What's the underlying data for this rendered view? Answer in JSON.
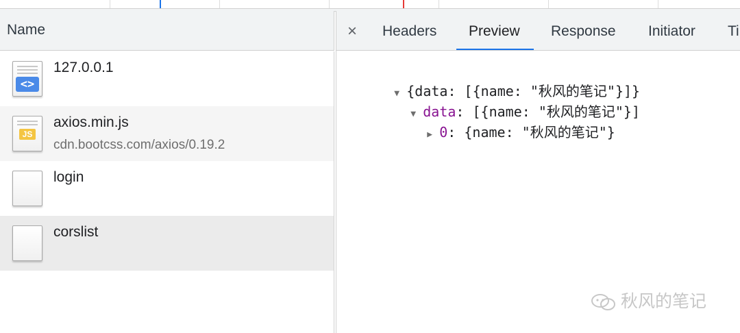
{
  "columns": {
    "name_header": "Name"
  },
  "requests": [
    {
      "name": "127.0.0.1",
      "subtitle": "",
      "icon": "html-document-icon"
    },
    {
      "name": "axios.min.js",
      "subtitle": "cdn.bootcss.com/axios/0.19.2",
      "icon": "javascript-file-icon"
    },
    {
      "name": "login",
      "subtitle": "",
      "icon": "generic-file-icon"
    },
    {
      "name": "corslist",
      "subtitle": "",
      "icon": "generic-file-icon"
    }
  ],
  "detail_tabs": {
    "close": "×",
    "headers": "Headers",
    "preview": "Preview",
    "response": "Response",
    "initiator": "Initiator",
    "timing": "Ti"
  },
  "preview": {
    "line1": "{data: [{name: \"秋风的笔记\"}]}",
    "line2_key": "data",
    "line2_rest": ": [{name: \"秋风的笔记\"}]",
    "line3_key": "0",
    "line3_rest": ": {name: \"秋风的笔记\"}",
    "expanded_arrow": "▼",
    "collapsed_arrow": "▶"
  },
  "watermark": {
    "text": "秋风的笔记",
    "icon": "wechat-icon"
  },
  "colors": {
    "accent": "#1a73e8",
    "key": "#881391",
    "timeline_blue": "#1a73e8",
    "timeline_red": "#e53935"
  }
}
